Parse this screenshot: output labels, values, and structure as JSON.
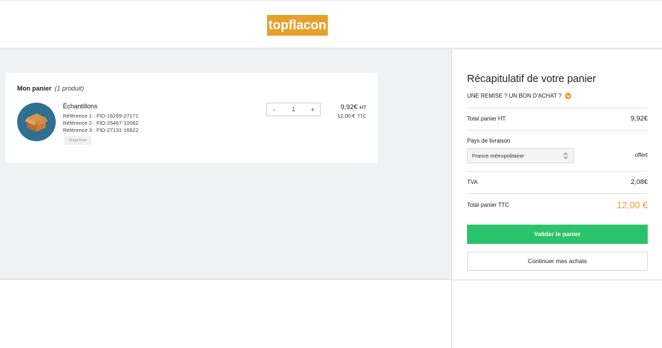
{
  "header": {
    "logo_text": "topflacon"
  },
  "cart": {
    "title": "Mon panier",
    "count": "(1 produit)",
    "product": {
      "name": "Échantillons",
      "refs": [
        "Référence 1 : FID-16269-27171",
        "Référence 2 : FID-25467-10062",
        "Référence 3 : FID-27131-16622"
      ],
      "delete_label": "Supprimer",
      "qty_minus": "-",
      "qty_value": "1",
      "qty_plus": "+",
      "price_ht": "9,92€",
      "price_ht_suffix": "HT",
      "price_ttc": "12,00 €",
      "price_ttc_suffix": "TTC",
      "icon": "box-icon"
    }
  },
  "summary": {
    "title": "Récapitulatif de votre panier",
    "discount_label": "UNE REMISE ? UN BON D'ACHAT ?",
    "total_ht_label": "Total panier HT",
    "total_ht_value": "9,92€",
    "country_label": "Pays de livraison",
    "country_value": "France métropolitaine",
    "shipping_value": "offert",
    "tva_label": "TVA",
    "tva_value": "2,08€",
    "total_ttc_label": "Total panier TTC",
    "total_ttc_value": "12,00 €",
    "validate_label": "Valider le panier",
    "continue_label": "Continuer mes achats"
  },
  "colors": {
    "brand": "#e7a02a",
    "validate": "#2bc36b",
    "background": "#f0f1f5"
  }
}
